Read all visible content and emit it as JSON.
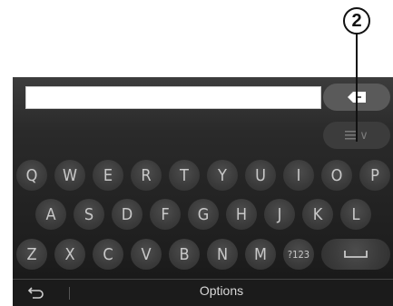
{
  "callout": {
    "number": "2"
  },
  "search": {
    "value": ""
  },
  "keyboard": {
    "row1": [
      "Q",
      "W",
      "E",
      "R",
      "T",
      "Y",
      "U",
      "I",
      "O",
      "P"
    ],
    "row2": [
      "A",
      "S",
      "D",
      "F",
      "G",
      "H",
      "J",
      "K",
      "L"
    ],
    "row3": [
      "Z",
      "X",
      "C",
      "V",
      "B",
      "N",
      "M",
      "?123"
    ]
  },
  "list_button": {
    "icon": "list-icon",
    "chevron": "∨"
  },
  "backspace_button": {
    "icon": "backspace-icon"
  },
  "space_key": {
    "icon": "space-icon"
  },
  "bottom_bar": {
    "options_label": "Options",
    "back_icon": "back-arrow-icon"
  }
}
